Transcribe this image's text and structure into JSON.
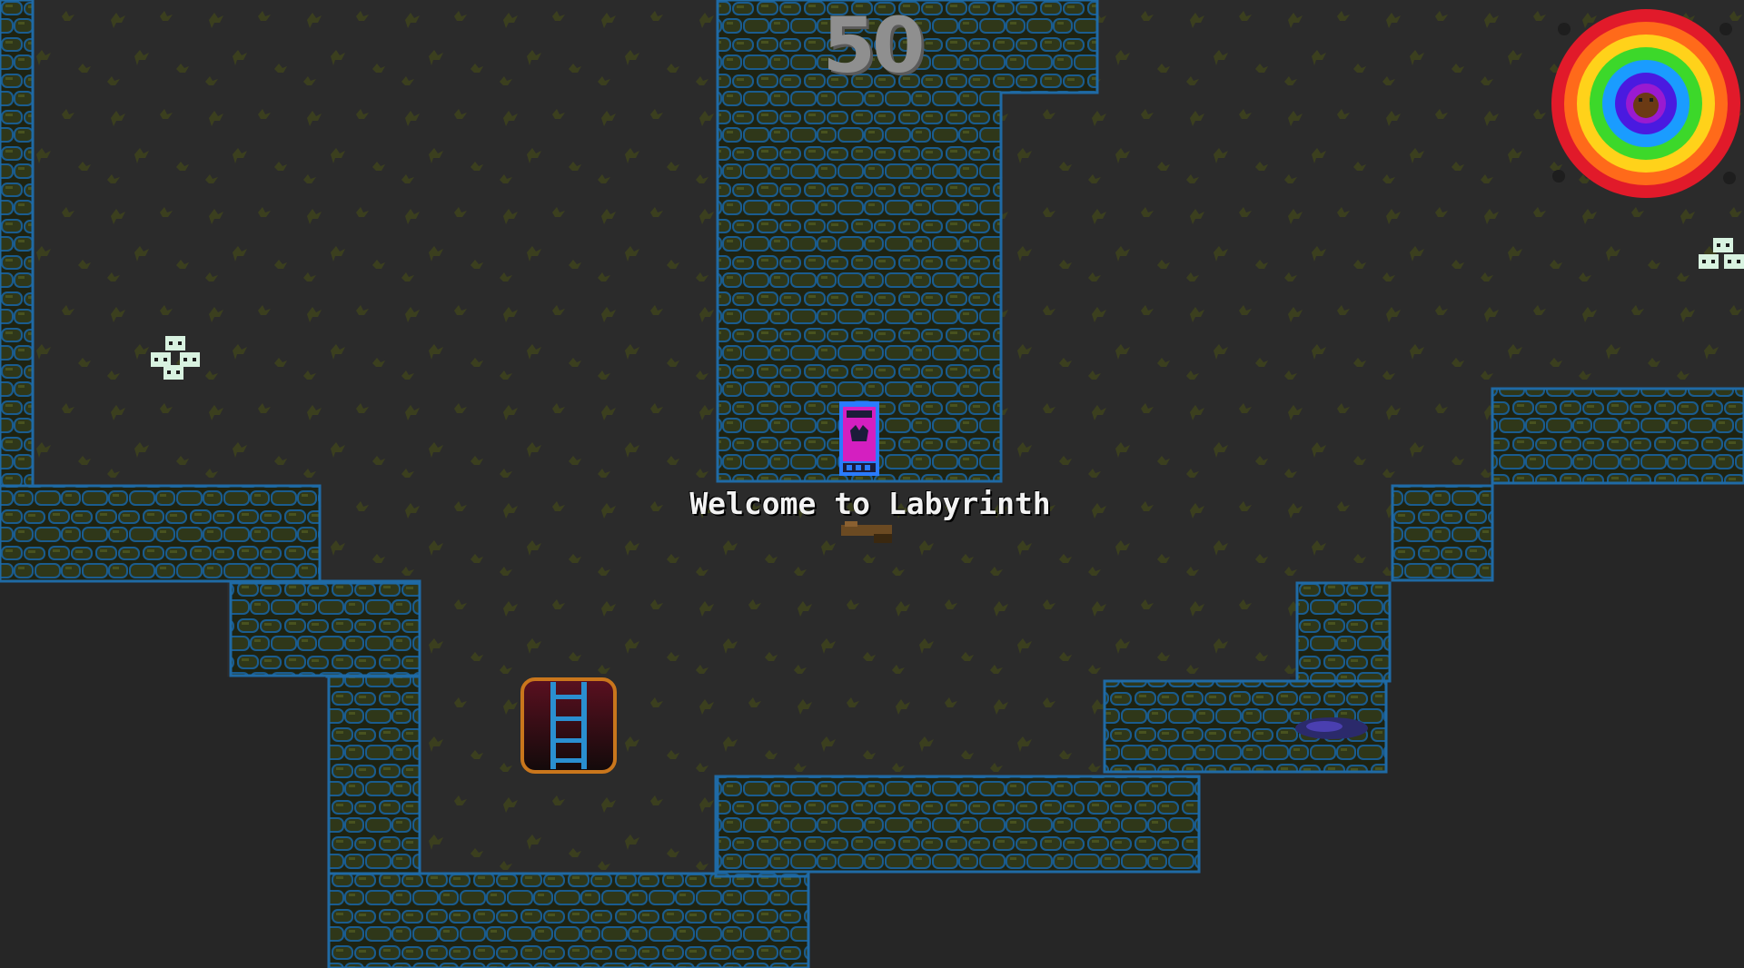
{
  "game": {
    "title": "Labyrinth",
    "score": "50",
    "welcome_message": "Welcome to Labyrinth"
  },
  "palette": {
    "background": "#262626",
    "floor": "#2b2b2b",
    "sprout": "#3b3f1e",
    "wall_stone": "#2d3418",
    "wall_highlight": "#46501f",
    "wall_edge": "#1f6aa5",
    "player_frame": "#2a7bff",
    "player_body": "#d41fc0"
  },
  "icons": {
    "player": "door-portal-icon",
    "ladder": "ladder-hatch-icon",
    "portal": "rainbow-orb-icon",
    "bones_left": "skull-pile-icon",
    "bones_right": "skull-pile-icon",
    "puddle": "purple-slime-icon",
    "boots": "boots-icon"
  }
}
